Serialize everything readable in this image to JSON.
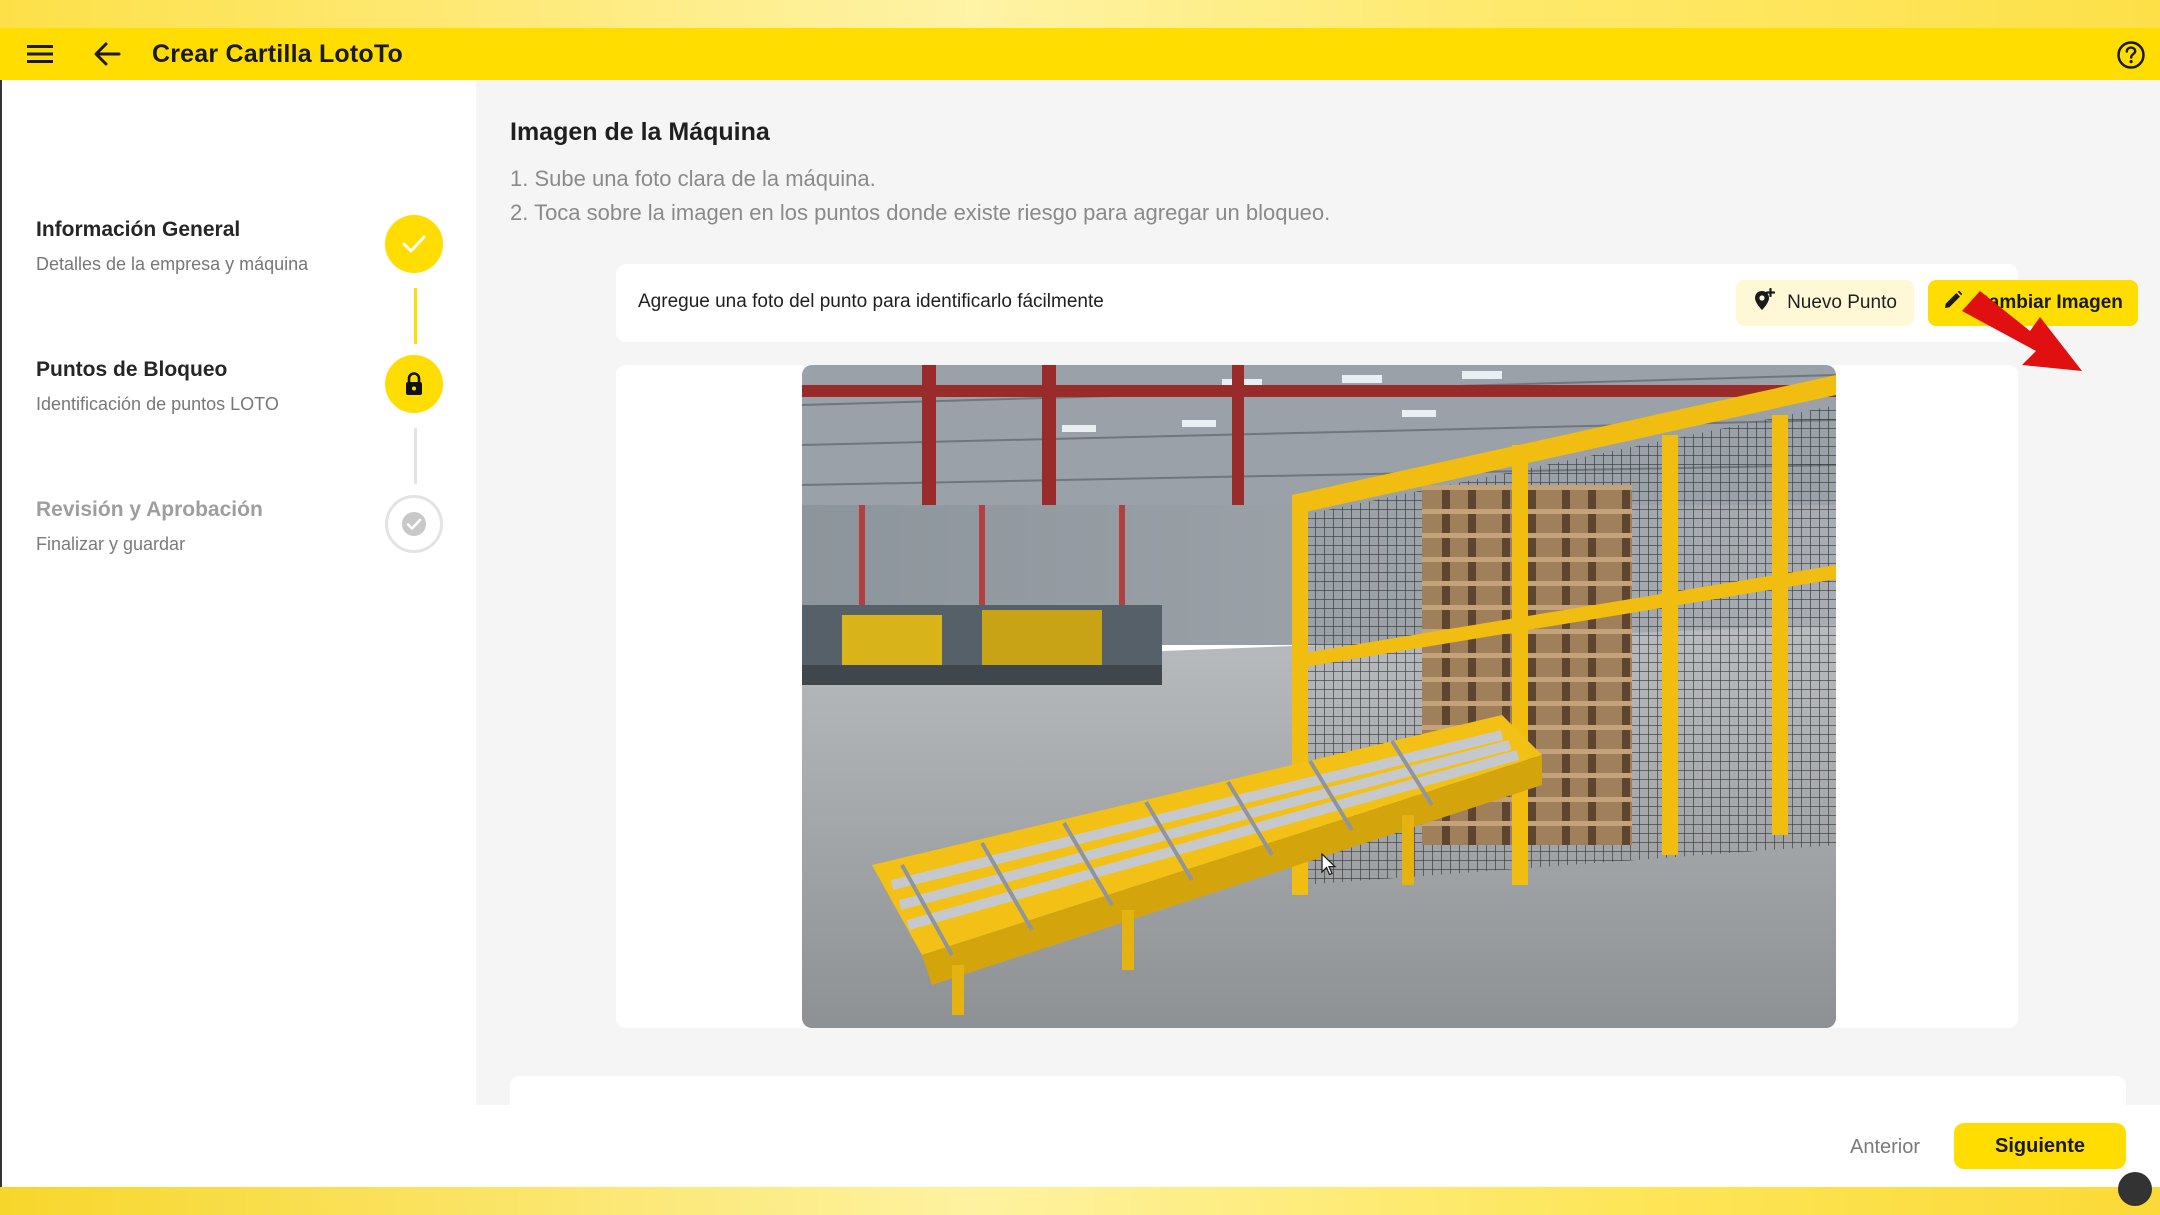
{
  "app": {
    "title": "Crear Cartilla LotoTo",
    "accent_color": "#ffdd00"
  },
  "stepper": {
    "steps": [
      {
        "title": "Información General",
        "subtitle": "Detalles de la empresa y máquina",
        "state": "completed",
        "icon": "check-icon"
      },
      {
        "title": "Puntos de Bloqueo",
        "subtitle": "Identificación de puntos LOTO",
        "state": "active",
        "icon": "lock-icon"
      },
      {
        "title": "Revisión y Aprobación",
        "subtitle": "Finalizar y guardar",
        "state": "pending",
        "icon": "check-circle-icon"
      }
    ]
  },
  "section": {
    "title": "Imagen de la Máquina",
    "instructions": [
      "1. Sube una foto clara de la máquina.",
      "2. Toca sobre la imagen en los puntos donde existe riesgo para agregar un bloqueo."
    ]
  },
  "toolbar": {
    "hint": "Agregue una foto del punto para identificarlo fácilmente",
    "new_point_label": "Nuevo Punto",
    "new_point_icon": "add-location-icon",
    "change_image_label": "Cambiar Imagen",
    "change_image_icon": "pencil-icon"
  },
  "image": {
    "subject": "machine-photo"
  },
  "footer": {
    "prev_label": "Anterior",
    "next_label": "Siguiente"
  }
}
